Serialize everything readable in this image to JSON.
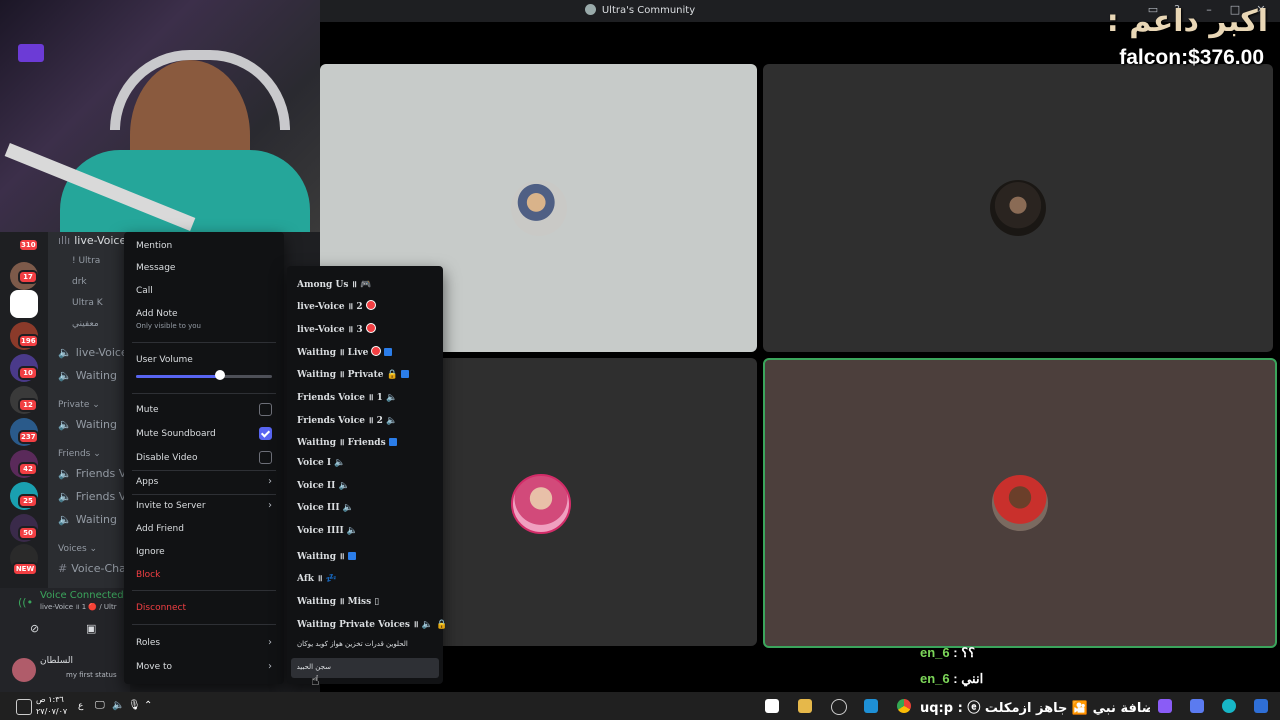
{
  "window": {
    "title": "Ultra's Community"
  },
  "overlay": {
    "arabic_text": "اكبر داعم :",
    "price_text": "falcon:$376.00"
  },
  "server_badges": [
    "310",
    "17",
    "196",
    "10",
    "12",
    "237",
    "42",
    "25",
    "50",
    "NEW"
  ],
  "channels": {
    "items": [
      "live-Voice",
      "! Ultra",
      "drk",
      "Ultra K",
      "معفيني",
      "live-Voice",
      "Waiting",
      "Waiting",
      "Friends V",
      "Friends V",
      "Waiting",
      "Voice-Cha"
    ],
    "categories": [
      "Private",
      "Friends",
      "Voices"
    ]
  },
  "voice_panel": {
    "status": "Voice Connected",
    "channel": "live-Voice ॥ 1 🔴 / Ultr"
  },
  "user_panel": {
    "name": "السلطان",
    "status": "my first status"
  },
  "context_menu": {
    "mention": "Mention",
    "message": "Message",
    "call": "Call",
    "add_note": "Add Note",
    "add_note_sub": "Only visible to you",
    "user_volume": "User Volume",
    "mute": "Mute",
    "mute_soundboard": "Mute Soundboard",
    "disable_video": "Disable Video",
    "apps": "Apps",
    "invite_to_server": "Invite to Server",
    "add_friend": "Add Friend",
    "ignore": "Ignore",
    "block": "Block",
    "disconnect": "Disconnect",
    "roles": "Roles",
    "move_to": "Move to",
    "user_volume_level": 0.5,
    "mute_soundboard_checked": true
  },
  "move_to_menu": {
    "items": [
      "Among Us ॥ 🎮",
      "live-Voice ॥ 2",
      "live-Voice ॥ 3",
      "Waiting ॥ Live",
      "Waiting ॥ Private 🔒",
      "Friends Voice ॥ 1 🔈",
      "Friends Voice ॥ 2 🔈",
      "Waiting ॥ Friends",
      "Voice I 🔈",
      "Voice II 🔈",
      "Voice III 🔈",
      "Voice IIII 🔈",
      "Waiting ॥",
      "Afk ॥ 💤",
      "Waiting ॥ Miss ▯",
      "Waiting Private Voices ॥ 🔈 🔒"
    ],
    "arabic_items": [
      "الحلوين قدرات تخزين هواز كوبد يوكان",
      "سجن الحبيد"
    ]
  },
  "chat": [
    {
      "user": "en_6",
      "text": "؟؟"
    },
    {
      "user": "en_6",
      "text": "انني"
    }
  ],
  "taskbar": {
    "time": "١:٣٦ ص",
    "date": "٢٧/٠٧/٠٧",
    "scrolling_text": "uq:p : ⓔ ثاني  اضافة نبي 🎦  جاهز ازمكلت"
  }
}
